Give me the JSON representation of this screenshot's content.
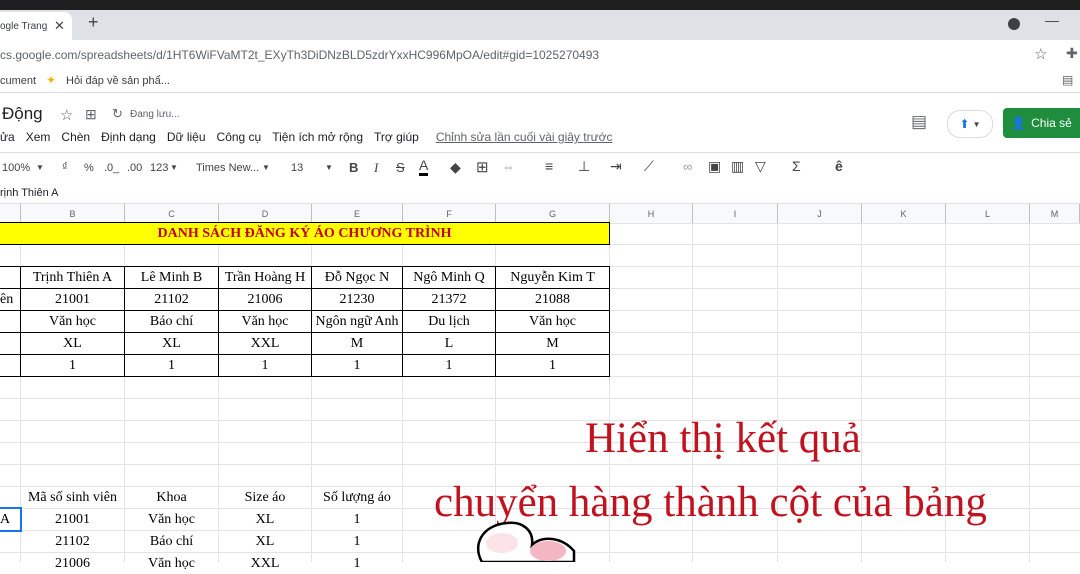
{
  "browser": {
    "tab_title": "ogle Trang",
    "tab_close": "✕",
    "new_tab": "+",
    "url": "cs.google.com/spreadsheets/d/1HT6WiFVaMT2t_EXyTh3DiDNzBLD5zdrYxxHC996MpOA/edit#gid=1025270493",
    "bookmarks": [
      "cument",
      "Hỏi đáp về sản phẩ..."
    ]
  },
  "doc": {
    "title": "Động",
    "saving_status": "Đang lưu...",
    "menu": [
      "ửa",
      "Xem",
      "Chèn",
      "Định dạng",
      "Dữ liệu",
      "Công cụ",
      "Tiện ích mở rộng",
      "Trợ giúp"
    ],
    "last_edit": "Chỉnh sửa lần cuối vài giây trước",
    "share_label": "Chia sẻ"
  },
  "toolbar": {
    "zoom": "100%",
    "currency": "₫",
    "percent": "%",
    "dec_less": ".0_",
    "dec_more": ".00",
    "more_formats": "123",
    "font": "Times New...",
    "font_size": "13",
    "bold": "B",
    "italic": "I",
    "strike": "S",
    "text_color": "A"
  },
  "formula_bar": {
    "content": "rịnh Thiên A"
  },
  "columns": [
    "B",
    "C",
    "D",
    "E",
    "F",
    "G",
    "H",
    "I",
    "J",
    "K",
    "L",
    "M"
  ],
  "sheet": {
    "title": "DANH SÁCH ĐĂNG KÝ ÁO CHƯƠNG TRÌNH",
    "row_label_partial": "ên",
    "names": [
      "Trịnh Thiên A",
      "Lê Minh B",
      "Trần Hoàng H",
      "Đỗ Ngọc N",
      "Ngô Minh Q",
      "Nguyễn Kim T"
    ],
    "ids": [
      "21001",
      "21102",
      "21006",
      "21230",
      "21372",
      "21088"
    ],
    "faculties": [
      "Văn học",
      "Báo chí",
      "Văn học",
      "Ngôn ngữ Anh",
      "Du lịch",
      "Văn học"
    ],
    "sizes": [
      "XL",
      "XL",
      "XXL",
      "M",
      "L",
      "M"
    ],
    "quantities": [
      "1",
      "1",
      "1",
      "1",
      "1",
      "1"
    ],
    "result_headers": [
      "Mã số sinh viên",
      "Khoa",
      "Size áo",
      "Số lượng áo"
    ],
    "result_first_col": "A",
    "result_rows": [
      [
        "21001",
        "Văn học",
        "XL",
        "1"
      ],
      [
        "21102",
        "Báo chí",
        "XL",
        "1"
      ],
      [
        "21006",
        "Văn học",
        "XXL",
        "1"
      ]
    ]
  },
  "overlay": {
    "line1": "Hiển thị kết quả",
    "line2": "chuyển hàng thành cột của bảng"
  },
  "colors": {
    "title_fill": "#ffff00",
    "title_text": "#c00000",
    "overlay_text": "#c1121f",
    "share_button": "#1e8e3e"
  }
}
